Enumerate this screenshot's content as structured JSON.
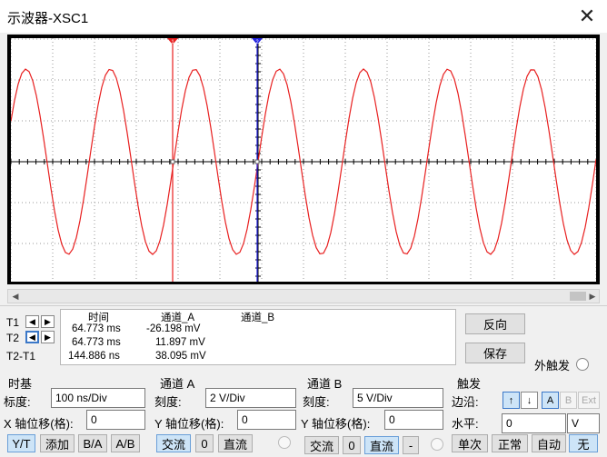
{
  "window": {
    "title": "示波器-XSC1",
    "close_glyph": "✕"
  },
  "colors": {
    "trace_a": "#e82020",
    "cursor1": "#e82020",
    "cursor2": "#2020e0"
  },
  "cursors": {
    "t1_label": "T1",
    "t2_label": "T2",
    "t2t1_label": "T2-T1",
    "marker1": "1",
    "marker2": "2",
    "left_arrow": "◀",
    "right_arrow": "▶"
  },
  "readout": {
    "headers": {
      "time": "时间",
      "ch_a": "通道_A",
      "ch_b": "通道_B"
    },
    "rows": [
      {
        "time": "64.773 ms",
        "ch_a": "-26.198 mV"
      },
      {
        "time": "64.773 ms",
        "ch_a": "11.897 mV"
      },
      {
        "time": "144.886 ns",
        "ch_a": "38.095 mV"
      }
    ]
  },
  "side_buttons": {
    "reverse": "反向",
    "save": "保存",
    "ext_trigger": "外触发"
  },
  "timebase": {
    "title": "时基",
    "scale_label": "标度:",
    "scale_value": "100 ns/Div",
    "xpos_label": "X 轴位移(格):",
    "xpos_value": "0",
    "modes": [
      "Y/T",
      "添加",
      "B/A",
      "A/B"
    ]
  },
  "channel_a": {
    "title": "通道 A",
    "scale_label": "刻度:",
    "scale_value": "2  V/Div",
    "ypos_label": "Y 轴位移(格):",
    "ypos_value": "0",
    "coupling": [
      "交流",
      "0",
      "直流"
    ]
  },
  "channel_b": {
    "title": "通道 B",
    "scale_label": "刻度:",
    "scale_value": "5  V/Div",
    "ypos_label": "Y 轴位移(格):",
    "ypos_value": "0",
    "coupling": [
      "交流",
      "0",
      "直流",
      "-"
    ]
  },
  "trigger": {
    "title": "触发",
    "edge_label": "边沿:",
    "level_label": "水平:",
    "level_value": "0",
    "level_unit": "V",
    "edge_rise": "↑",
    "edge_fall": "↓",
    "sources": [
      "A",
      "B",
      "Ext"
    ],
    "modes": [
      "单次",
      "正常",
      "自动",
      "无"
    ]
  },
  "scrollbar": {
    "left": "◀",
    "right": "▶"
  }
}
